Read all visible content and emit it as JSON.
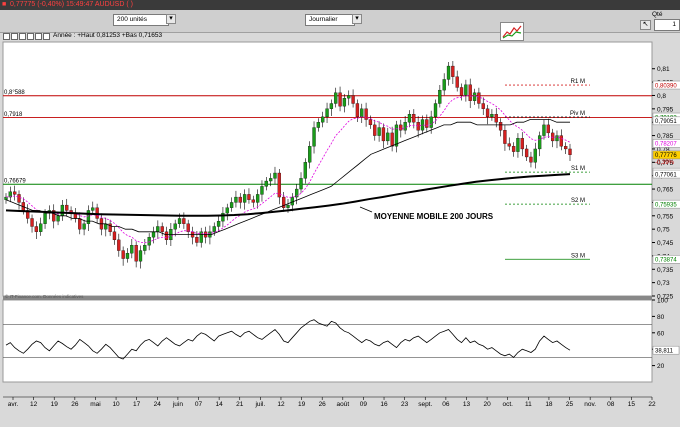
{
  "header": {
    "symbol_readout": "0,77775 (-0,40%) 15:49:47 AUDUSD ( )",
    "units": "200 unités",
    "period": "Journalier",
    "qty_label": "Qté",
    "qty_value": "1"
  },
  "legend": {
    "ohlc_text": "Année : +Haut 0,81253 +Bas 0,71653"
  },
  "colors": {
    "up_candle": "#1a9c1a",
    "down_candle": "#d42020",
    "ema": "#e000e0",
    "sma50": "#000000",
    "sma200": "#000000",
    "resistance": "#c00000",
    "support": "#008000",
    "title_text": "#ff4040"
  },
  "chart_data": {
    "type": "candlestick",
    "ylim": [
      0.725,
      0.82
    ],
    "y_ticks": [
      "0,81",
      "0,805",
      "0,8",
      "0,795",
      "0,79",
      "0,785",
      "0,78",
      "0,775",
      "0,77",
      "0,765",
      "0,76",
      "0,755",
      "0,75",
      "0,745",
      "0,74",
      "0,735",
      "0,73",
      "0,725"
    ],
    "x_ticks": [
      "avr.",
      "12",
      "19",
      "26",
      "mai",
      "10",
      "17",
      "24",
      "juin",
      "07",
      "14",
      "21",
      "juil.",
      "12",
      "19",
      "26",
      "août",
      "09",
      "16",
      "23",
      "sept.",
      "06",
      "13",
      "20",
      "oct.",
      "11",
      "18",
      "25",
      "nov.",
      "08",
      "15",
      "22"
    ],
    "annotation": "MOYENNE MOBILE 200 JOURS",
    "levels": [
      {
        "label": "R1 M",
        "value": 0.8039,
        "value_text": "0,80390",
        "style": "dashed-red"
      },
      {
        "label": "Piv M",
        "value": 0.79193,
        "value_text": "0,79193",
        "style": "dashed-black"
      },
      {
        "label": "S1 M",
        "value": 0.77132,
        "value_text": "0,77132",
        "style": "dashed-green"
      },
      {
        "label": "S2 M",
        "value": 0.75935,
        "value_text": "0,75935",
        "style": "dashed-green"
      },
      {
        "label": "S3 M",
        "value": 0.73874,
        "value_text": "0,73874",
        "style": "solid-green"
      }
    ],
    "hlines": [
      {
        "label": "0,8 0,8 0,8",
        "display": "0,8°588",
        "value": 0.7999,
        "color": "#c00000"
      },
      {
        "label": "0,7918",
        "display": "0,7918",
        "value": 0.7918,
        "color": "#c00000"
      },
      {
        "label": "0,76679",
        "display": "0,76679",
        "value": 0.7668,
        "color": "#008000"
      }
    ],
    "right_labels": [
      {
        "text": "0,79051",
        "value": 0.79051,
        "bg": "#ffffff",
        "fg": "#000"
      },
      {
        "text": "0,78207",
        "value": 0.78207,
        "bg": "#ffffff",
        "fg": "#e000e0"
      },
      {
        "text": "0,77776",
        "value": 0.77776,
        "bg": "#ffd000",
        "fg": "#000"
      },
      {
        "text": "-0,39%",
        "value": 0.7752,
        "bg": "none",
        "fg": "#c00000"
      },
      {
        "text": "0,77061",
        "value": 0.77061,
        "bg": "#ffffff",
        "fg": "#000"
      }
    ],
    "close_series": [
      0.762,
      0.764,
      0.763,
      0.76,
      0.757,
      0.754,
      0.751,
      0.749,
      0.752,
      0.756,
      0.757,
      0.753,
      0.755,
      0.759,
      0.757,
      0.756,
      0.754,
      0.75,
      0.752,
      0.757,
      0.758,
      0.754,
      0.75,
      0.752,
      0.749,
      0.746,
      0.742,
      0.739,
      0.741,
      0.744,
      0.738,
      0.742,
      0.744,
      0.747,
      0.749,
      0.751,
      0.749,
      0.746,
      0.75,
      0.752,
      0.754,
      0.752,
      0.749,
      0.747,
      0.745,
      0.749,
      0.747,
      0.749,
      0.751,
      0.753,
      0.756,
      0.758,
      0.76,
      0.762,
      0.76,
      0.763,
      0.761,
      0.76,
      0.763,
      0.766,
      0.768,
      0.769,
      0.771,
      0.762,
      0.758,
      0.759,
      0.762,
      0.765,
      0.769,
      0.775,
      0.781,
      0.788,
      0.79,
      0.792,
      0.795,
      0.797,
      0.801,
      0.796,
      0.799,
      0.8,
      0.797,
      0.792,
      0.795,
      0.791,
      0.789,
      0.785,
      0.788,
      0.783,
      0.786,
      0.781,
      0.789,
      0.787,
      0.79,
      0.793,
      0.79,
      0.787,
      0.791,
      0.788,
      0.792,
      0.797,
      0.802,
      0.806,
      0.811,
      0.807,
      0.803,
      0.8,
      0.804,
      0.798,
      0.801,
      0.797,
      0.795,
      0.792,
      0.793,
      0.79,
      0.787,
      0.782,
      0.781,
      0.779,
      0.784,
      0.78,
      0.777,
      0.775,
      0.78,
      0.785,
      0.789,
      0.786,
      0.783,
      0.785,
      0.781,
      0.78,
      0.7778
    ],
    "sma50": [
      0.761,
      0.76,
      0.759,
      0.758,
      0.757,
      0.757,
      0.756,
      0.756,
      0.755,
      0.755,
      0.754,
      0.754,
      0.753,
      0.753,
      0.752,
      0.752,
      0.751,
      0.751,
      0.75,
      0.75,
      0.749,
      0.749,
      0.749,
      0.749,
      0.748,
      0.748,
      0.748,
      0.748,
      0.748,
      0.748,
      0.748,
      0.748,
      0.749,
      0.75,
      0.751,
      0.752,
      0.753,
      0.754,
      0.755,
      0.756,
      0.757,
      0.758,
      0.759,
      0.76,
      0.761,
      0.762,
      0.763,
      0.764,
      0.765,
      0.766,
      0.768,
      0.77,
      0.772,
      0.774,
      0.776,
      0.778,
      0.779,
      0.78,
      0.781,
      0.782,
      0.783,
      0.784,
      0.785,
      0.786,
      0.787,
      0.788,
      0.789,
      0.789,
      0.79,
      0.79,
      0.79,
      0.789,
      0.789,
      0.789,
      0.789,
      0.789,
      0.789,
      0.79,
      0.79,
      0.791,
      0.791,
      0.791,
      0.791,
      0.79,
      0.79,
      0.79
    ],
    "sma200": [
      0.757,
      0.7568,
      0.7566,
      0.7564,
      0.7562,
      0.756,
      0.7558,
      0.7556,
      0.7555,
      0.7554,
      0.7553,
      0.7552,
      0.7551,
      0.755,
      0.755,
      0.755,
      0.7551,
      0.7553,
      0.7556,
      0.756,
      0.7565,
      0.757,
      0.7576,
      0.7582,
      0.7588,
      0.7595,
      0.7603,
      0.7612,
      0.762,
      0.7629,
      0.7638,
      0.7646,
      0.7654,
      0.7662,
      0.767,
      0.7677,
      0.7683,
      0.7688,
      0.7693,
      0.7697,
      0.77,
      0.7703,
      0.7706
    ],
    "rsi": {
      "ylim": [
        0,
        100
      ],
      "ticks": [
        "100",
        "80",
        "60",
        "40",
        "20"
      ],
      "upper": 70,
      "lower": 30,
      "last_value": "38,811",
      "values": [
        45,
        48,
        42,
        38,
        35,
        40,
        46,
        50,
        48,
        42,
        38,
        44,
        50,
        47,
        43,
        40,
        45,
        52,
        48,
        44,
        38,
        35,
        40,
        46,
        42,
        36,
        30,
        28,
        34,
        40,
        38,
        45,
        50,
        52,
        48,
        44,
        50,
        54,
        50,
        46,
        44,
        48,
        52,
        50,
        56,
        60,
        58,
        54,
        50,
        56,
        58,
        60,
        62,
        58,
        55,
        60,
        62,
        58,
        54,
        52,
        56,
        60,
        64,
        58,
        50,
        48,
        54,
        60,
        66,
        70,
        74,
        76,
        72,
        70,
        68,
        74,
        72,
        66,
        62,
        60,
        56,
        52,
        48,
        52,
        50,
        46,
        44,
        48,
        50,
        46,
        42,
        48,
        52,
        50,
        54,
        56,
        52,
        48,
        52,
        56,
        60,
        62,
        64,
        58,
        52,
        48,
        54,
        48,
        50,
        46,
        44,
        40,
        42,
        38,
        34,
        32,
        34,
        30,
        36,
        40,
        38,
        36,
        40,
        50,
        56,
        52,
        48,
        50,
        46,
        42,
        38.8
      ]
    }
  }
}
